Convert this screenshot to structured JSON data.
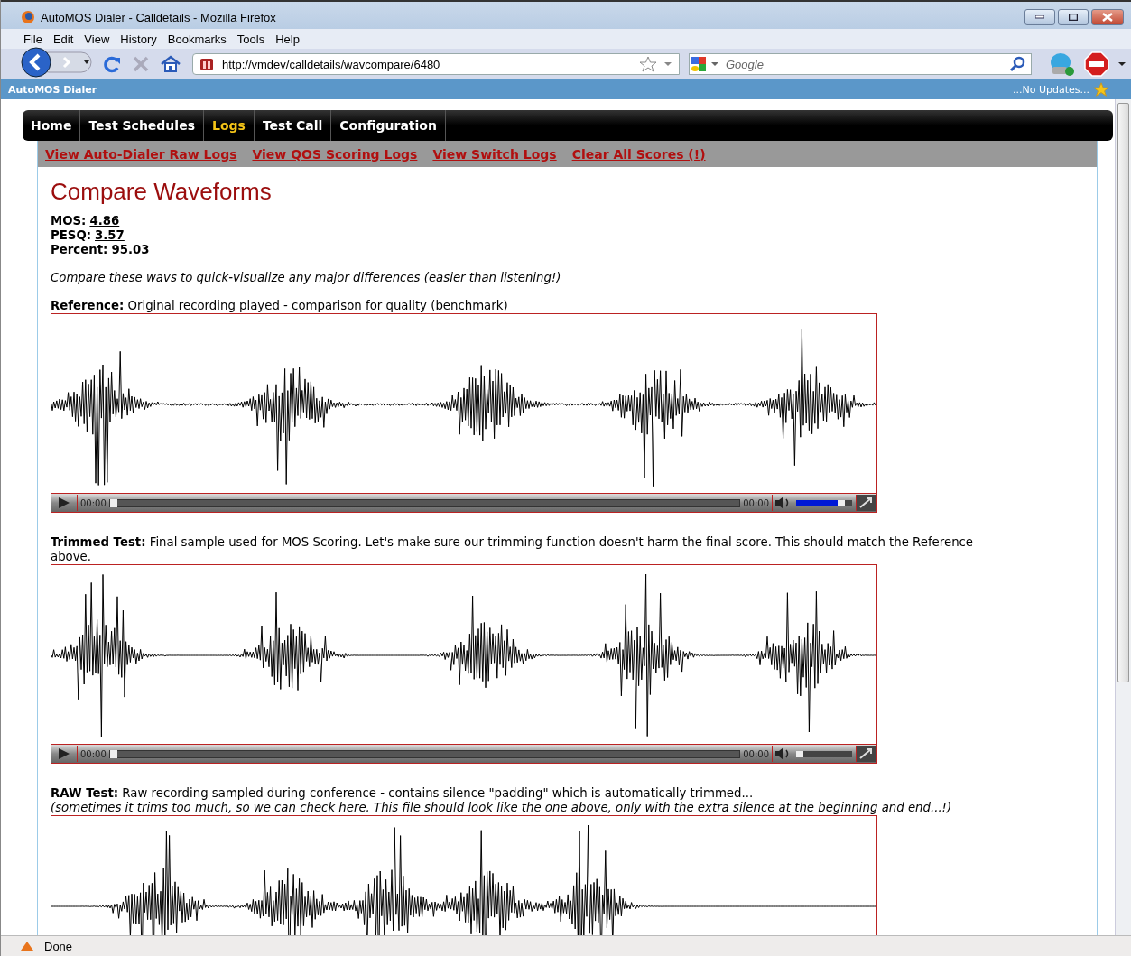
{
  "window": {
    "title": "AutoMOS Dialer - Calldetails - Mozilla Firefox"
  },
  "menu": [
    "File",
    "Edit",
    "View",
    "History",
    "Bookmarks",
    "Tools",
    "Help"
  ],
  "address": {
    "value": "http://vmdev/calldetails/wavcompare/6480"
  },
  "search": {
    "placeholder": "Google"
  },
  "addon_bar": {
    "title": "AutoMOS Dialer",
    "status": "...No Updates..."
  },
  "nav": [
    {
      "label": "Home",
      "selected": false
    },
    {
      "label": "Test Schedules",
      "selected": false
    },
    {
      "label": "Logs",
      "selected": true
    },
    {
      "label": "Test Call",
      "selected": false
    },
    {
      "label": "Configuration",
      "selected": false
    }
  ],
  "subnav": [
    "View Auto-Dialer Raw Logs",
    "View QOS Scoring Logs",
    "View Switch Logs",
    "Clear All Scores (!)"
  ],
  "heading": "Compare Waveforms",
  "scores": [
    {
      "label": "MOS:",
      "value": "4.86"
    },
    {
      "label": "PESQ:",
      "value": "3.57"
    },
    {
      "label": "Percent:",
      "value": "95.03"
    }
  ],
  "intro": "Compare these wavs to quick-visualize any major differences (easier than listening!)",
  "waves": [
    {
      "label": "Reference:",
      "text": "Original recording played -  comparison for quality (benchmark)",
      "player": {
        "elapsed": "00:00",
        "duration": "00:00",
        "progress": {
          "level": 0
        },
        "volume": {
          "level": 0.85
        }
      }
    },
    {
      "label": "Trimmed Test:",
      "text": "Final sample used for MOS Scoring. Let's make sure our trimming function doesn't harm the final score. This should match the Reference above.",
      "player": {
        "elapsed": "00:00",
        "duration": "00:00",
        "progress": {
          "level": 0
        },
        "volume": {
          "level": 0
        }
      }
    },
    {
      "label": "RAW Test:",
      "text": "Raw recording sampled during conference - contains silence \"padding\" which is automatically trimmed...",
      "note": "(sometimes it trims too much, so we can check here. This file should look like the one above, only with the extra silence at the beginning and end...!)"
    }
  ],
  "status_bar": {
    "text": "Done"
  }
}
